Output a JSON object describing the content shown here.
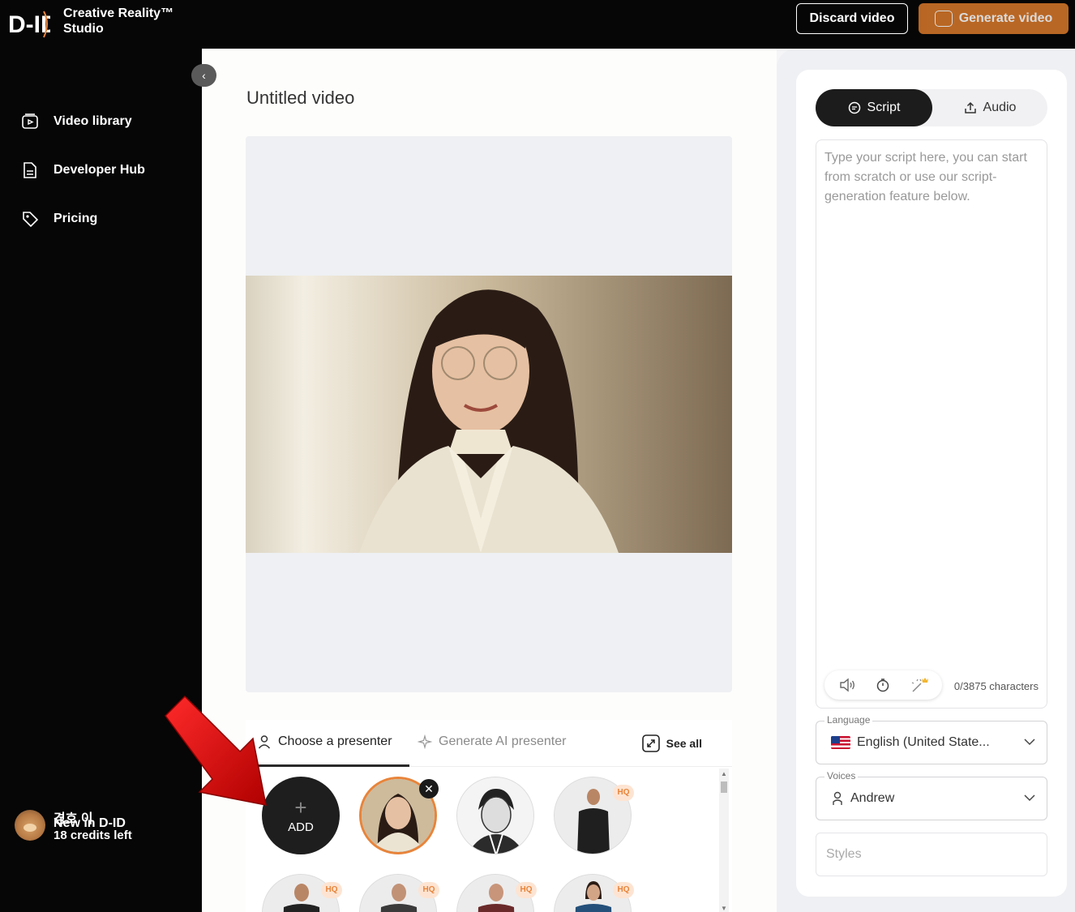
{
  "app": {
    "logo_text": "D-ID",
    "product_line1": "Creative Reality™",
    "product_line2": "Studio"
  },
  "topbar": {
    "discard_label": "Discard video",
    "generate_label": "Generate video"
  },
  "sidebar": {
    "items": [
      {
        "label": "Video library",
        "icon": "video-library-icon"
      },
      {
        "label": "Developer Hub",
        "icon": "document-icon"
      },
      {
        "label": "Pricing",
        "icon": "tag-icon"
      }
    ],
    "whats_new": "New in D-ID",
    "user": {
      "name": "경호 이",
      "credits": "18 credits left"
    }
  },
  "main": {
    "title": "Untitled video",
    "tabs": [
      {
        "label": "Choose a presenter",
        "icon": "person-icon"
      },
      {
        "label": "Generate AI presenter",
        "icon": "sparkle-icon"
      }
    ],
    "see_all": "See all",
    "add_label": "ADD",
    "hq_badge": "HQ"
  },
  "right": {
    "tabs": [
      {
        "label": "Script",
        "icon": "chat-icon"
      },
      {
        "label": "Audio",
        "icon": "upload-icon"
      }
    ],
    "script_placeholder": "Type your script here, you can start from scratch or use our script-generation feature below.",
    "char_count": "0/3875 characters",
    "language": {
      "label": "Language",
      "value": "English (United State..."
    },
    "voices": {
      "label": "Voices",
      "value": "Andrew"
    },
    "styles_placeholder": "Styles"
  },
  "colors": {
    "accent": "#d9782a",
    "selected_ring": "#e8843a",
    "annotation_arrow": "#e01010"
  }
}
